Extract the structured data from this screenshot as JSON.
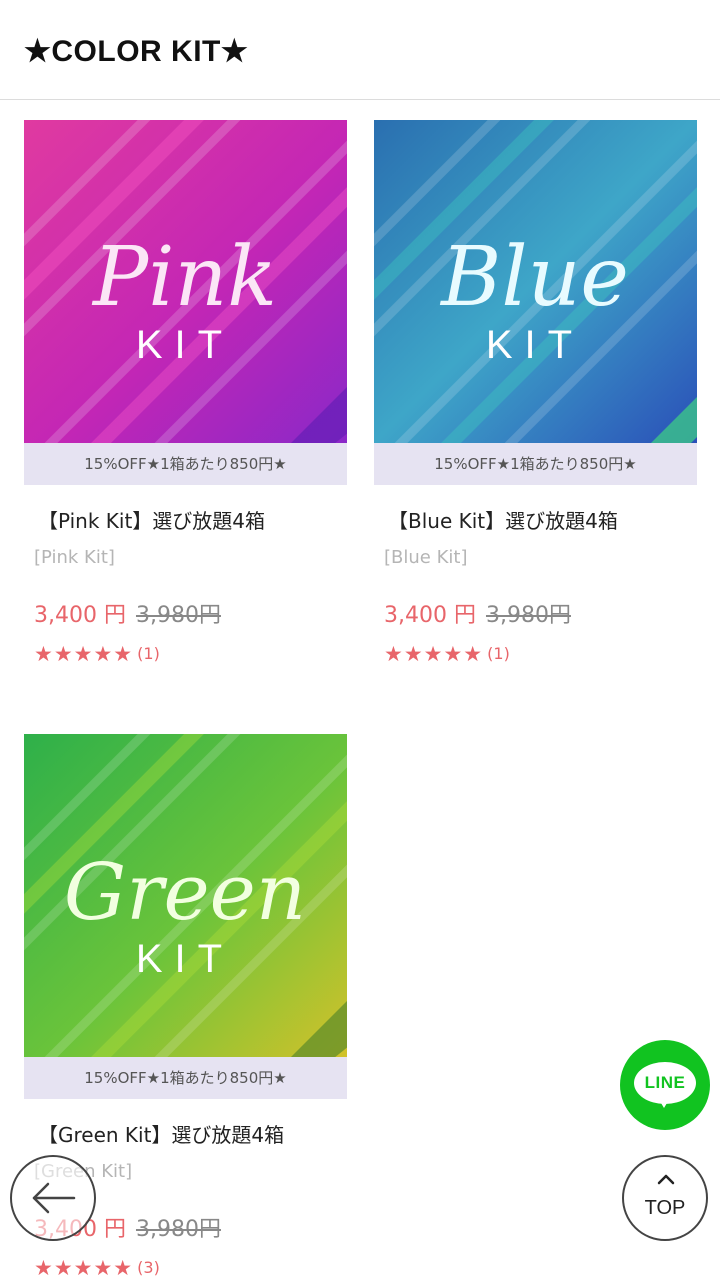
{
  "header": {
    "title": "★COLOR KIT★"
  },
  "products": [
    {
      "image_word": "Pink",
      "image_kit": "KIT",
      "promo": "15%OFF★1箱あたり850円★",
      "title": "【Pink Kit】選び放題4箱",
      "subtitle": "[Pink Kit]",
      "price": "3,400 円",
      "original_price": "3,980円",
      "stars": "★★★★★",
      "review_count": "(1)",
      "rating": 5,
      "colors": [
        "#b81fa8",
        "#e03aa0",
        "#8a28c8"
      ]
    },
    {
      "image_word": "Blue",
      "image_kit": "KIT",
      "promo": "15%OFF★1箱あたり850円★",
      "title": "【Blue Kit】選び放題4箱",
      "subtitle": "[Blue Kit]",
      "price": "3,400 円",
      "original_price": "3,980円",
      "stars": "★★★★★",
      "review_count": "(1)",
      "rating": 5,
      "colors": [
        "#2a8fb0",
        "#3ea6c8",
        "#2a4fb8"
      ]
    },
    {
      "image_word": "Green",
      "image_kit": "KIT",
      "promo": "15%OFF★1箱あたり850円★",
      "title": "【Green Kit】選び放題4箱",
      "subtitle": "[Green Kit]",
      "price": "3,400 円",
      "original_price": "3,980円",
      "stars": "★★★★★",
      "review_count": "(3)",
      "rating": 5,
      "colors": [
        "#2eb04a",
        "#6cc43a",
        "#d2c22a"
      ]
    }
  ],
  "floating": {
    "line_label": "LINE",
    "top_label": "TOP",
    "back_icon": "arrow-left-icon",
    "top_icon": "chevron-up-icon"
  },
  "accent": "#e8656a"
}
